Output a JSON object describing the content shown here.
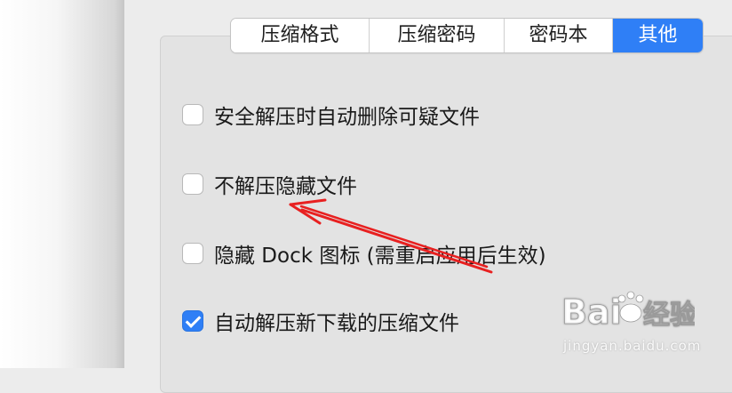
{
  "tabs": [
    {
      "label": "压缩格式",
      "active": false
    },
    {
      "label": "压缩密码",
      "active": false
    },
    {
      "label": "密码本",
      "active": false
    },
    {
      "label": "其他",
      "active": true
    }
  ],
  "options": [
    {
      "label": "安全解压时自动删除可疑文件",
      "checked": false
    },
    {
      "label": "不解压隐藏文件",
      "checked": false
    },
    {
      "label": "隐藏 Dock 图标 (需重启应用后生效)",
      "checked": false
    },
    {
      "label": "自动解压新下载的压缩文件",
      "checked": true
    }
  ],
  "annotation": {
    "type": "arrow",
    "color": "#e82020"
  },
  "watermark": {
    "logo_text": "Baidu经验",
    "url": "jingyan.baidu.com"
  },
  "colors": {
    "accent": "#2f7ff6"
  }
}
